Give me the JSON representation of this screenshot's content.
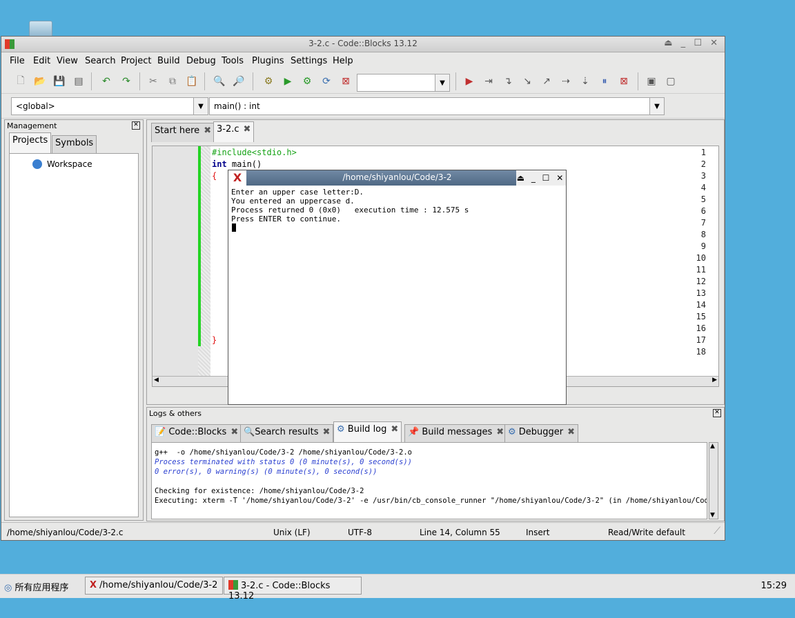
{
  "window": {
    "title": "3-2.c - Code::Blocks 13.12",
    "controls": "⏏ _ ☐ ✕"
  },
  "menu": [
    "File",
    "Edit",
    "View",
    "Search",
    "Project",
    "Build",
    "Debug",
    "Tools",
    "Plugins",
    "Settings",
    "Help"
  ],
  "scope": {
    "global": "<global>",
    "function": "main() : int"
  },
  "management": {
    "title": "Management",
    "tabs": [
      "Projects",
      "Symbols"
    ],
    "tree_root": "Workspace"
  },
  "editor": {
    "tabs": [
      "Start here",
      "3-2.c"
    ],
    "line_numbers": [
      "1",
      "2",
      "3",
      "4",
      "5",
      "6",
      "7",
      "8",
      "9",
      "10",
      "11",
      "12",
      "13",
      "14",
      "15",
      "16",
      "17",
      "18"
    ],
    "code": {
      "l1": "#include<stdio.h>",
      "l2_kw": "int",
      "l2_rest": " main()",
      "l3": "{",
      "l17": "}"
    }
  },
  "terminal": {
    "title": "/home/shiyanlou/Code/3-2",
    "controls": "⏏ _ ☐ ✕",
    "lines": [
      "Enter an upper case letter:D.",
      "You entered an uppercase d.",
      "Process returned 0 (0x0)   execution time : 12.575 s",
      "Press ENTER to continue."
    ]
  },
  "logs": {
    "title": "Logs & others",
    "tabs": [
      "Code::Blocks",
      "Search results",
      "Build log",
      "Build messages",
      "Debugger"
    ],
    "lines": [
      "g++  -o /home/shiyanlou/Code/3-2 /home/shiyanlou/Code/3-2.o",
      "Process terminated with status 0 (0 minute(s), 0 second(s))",
      "0 error(s), 0 warning(s) (0 minute(s), 0 second(s))",
      "",
      "Checking for existence: /home/shiyanlou/Code/3-2",
      "Executing: xterm -T '/home/shiyanlou/Code/3-2' -e /usr/bin/cb_console_runner \"/home/shiyanlou/Code/3-2\" (in /home/shiyanlou/Code)"
    ]
  },
  "status": {
    "file": "/home/shiyanlou/Code/3-2.c",
    "eol": "Unix (LF)",
    "encoding": "UTF-8",
    "position": "Line 14, Column 55",
    "mode": "Insert",
    "access": "Read/Write  default"
  },
  "taskbar": {
    "start": "所有应用程序",
    "tasks": [
      "/home/shiyanlou/Code/3-2",
      "3-2.c - Code::Blocks 13.12"
    ],
    "clock": "15:29"
  },
  "colors": {
    "desktop": "#52aedc",
    "code_green": "#16a316",
    "code_keyword": "#00008b",
    "brace_red": "#e01010",
    "changebar": "#23d423"
  }
}
